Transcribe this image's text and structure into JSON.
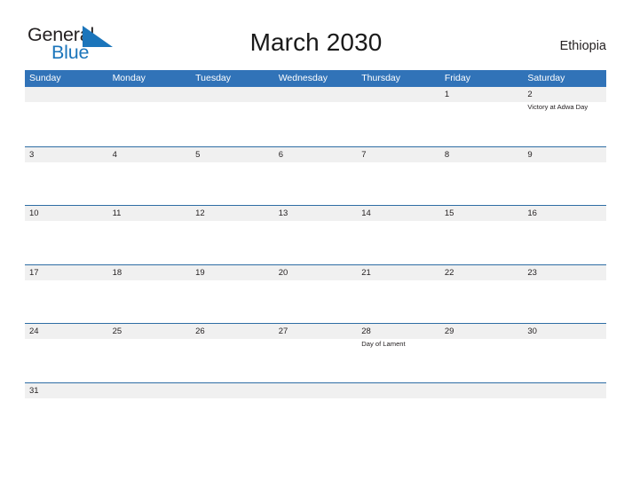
{
  "brand": {
    "name_part1": "General",
    "name_part2": "Blue",
    "triangle_icon": "triangle-icon",
    "color_dark": "#231f20",
    "color_blue": "#1b75bb"
  },
  "header": {
    "title": "March 2030",
    "country": "Ethiopia"
  },
  "colors": {
    "header_blue": "#3173b8",
    "row_border_blue": "#2e6da4",
    "date_strip_gray": "#f0f0f0",
    "text": "#231f20",
    "page_background": "#ffffff"
  },
  "calendar": {
    "month": "March",
    "year": "2030",
    "weekday_headers": [
      "Sunday",
      "Monday",
      "Tuesday",
      "Wednesday",
      "Thursday",
      "Friday",
      "Saturday"
    ],
    "weeks": [
      [
        {
          "day": "",
          "event": ""
        },
        {
          "day": "",
          "event": ""
        },
        {
          "day": "",
          "event": ""
        },
        {
          "day": "",
          "event": ""
        },
        {
          "day": "",
          "event": ""
        },
        {
          "day": "1",
          "event": ""
        },
        {
          "day": "2",
          "event": "Victory at Adwa Day"
        }
      ],
      [
        {
          "day": "3",
          "event": ""
        },
        {
          "day": "4",
          "event": ""
        },
        {
          "day": "5",
          "event": ""
        },
        {
          "day": "6",
          "event": ""
        },
        {
          "day": "7",
          "event": ""
        },
        {
          "day": "8",
          "event": ""
        },
        {
          "day": "9",
          "event": ""
        }
      ],
      [
        {
          "day": "10",
          "event": ""
        },
        {
          "day": "11",
          "event": ""
        },
        {
          "day": "12",
          "event": ""
        },
        {
          "day": "13",
          "event": ""
        },
        {
          "day": "14",
          "event": ""
        },
        {
          "day": "15",
          "event": ""
        },
        {
          "day": "16",
          "event": ""
        }
      ],
      [
        {
          "day": "17",
          "event": ""
        },
        {
          "day": "18",
          "event": ""
        },
        {
          "day": "19",
          "event": ""
        },
        {
          "day": "20",
          "event": ""
        },
        {
          "day": "21",
          "event": ""
        },
        {
          "day": "22",
          "event": ""
        },
        {
          "day": "23",
          "event": ""
        }
      ],
      [
        {
          "day": "24",
          "event": ""
        },
        {
          "day": "25",
          "event": ""
        },
        {
          "day": "26",
          "event": ""
        },
        {
          "day": "27",
          "event": ""
        },
        {
          "day": "28",
          "event": "Day of Lament"
        },
        {
          "day": "29",
          "event": ""
        },
        {
          "day": "30",
          "event": ""
        }
      ],
      [
        {
          "day": "31",
          "event": ""
        },
        {
          "day": "",
          "event": ""
        },
        {
          "day": "",
          "event": ""
        },
        {
          "day": "",
          "event": ""
        },
        {
          "day": "",
          "event": ""
        },
        {
          "day": "",
          "event": ""
        },
        {
          "day": "",
          "event": ""
        }
      ]
    ]
  }
}
